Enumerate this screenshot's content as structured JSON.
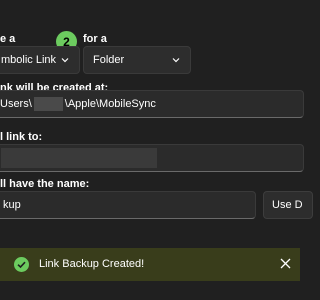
{
  "labels": {
    "create_a": "e a",
    "for_a": "for a",
    "link_location": "nk will be created at:",
    "link_to": "l link to:",
    "name": "ll have the name:"
  },
  "selects": {
    "link_type": "mbolic Link",
    "target_type": "Folder"
  },
  "step_badge": "2",
  "fields": {
    "location_prefix": "Users\\",
    "location_suffix": "\\Apple\\MobileSync",
    "link_to_value": "",
    "name_value": "kup"
  },
  "buttons": {
    "use_default": "Use D"
  },
  "toast": {
    "message": "Link Backup Created!",
    "accent": "#6ccb5f"
  },
  "icons": [
    "chevron-down-icon",
    "success-check-icon",
    "close-icon"
  ]
}
